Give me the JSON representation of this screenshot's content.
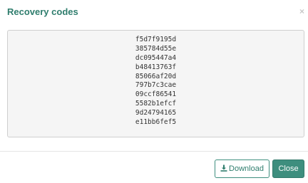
{
  "dialog": {
    "title": "Recovery codes",
    "close_glyph": "×"
  },
  "recovery_codes": [
    "f5d7f9195d",
    "385784d55e",
    "dc095447a4",
    "b48413763f",
    "85066af20d",
    "797b7c3cae",
    "09ccf86541",
    "5582b1efcf",
    "9d24794165",
    "e11bb6fef5"
  ],
  "footer": {
    "download_label": "Download",
    "download_icon": "download-icon",
    "close_label": "Close"
  },
  "colors": {
    "accent": "#3e8e7e",
    "title": "#2f7d6d",
    "codes_background": "#f5f5f5"
  }
}
